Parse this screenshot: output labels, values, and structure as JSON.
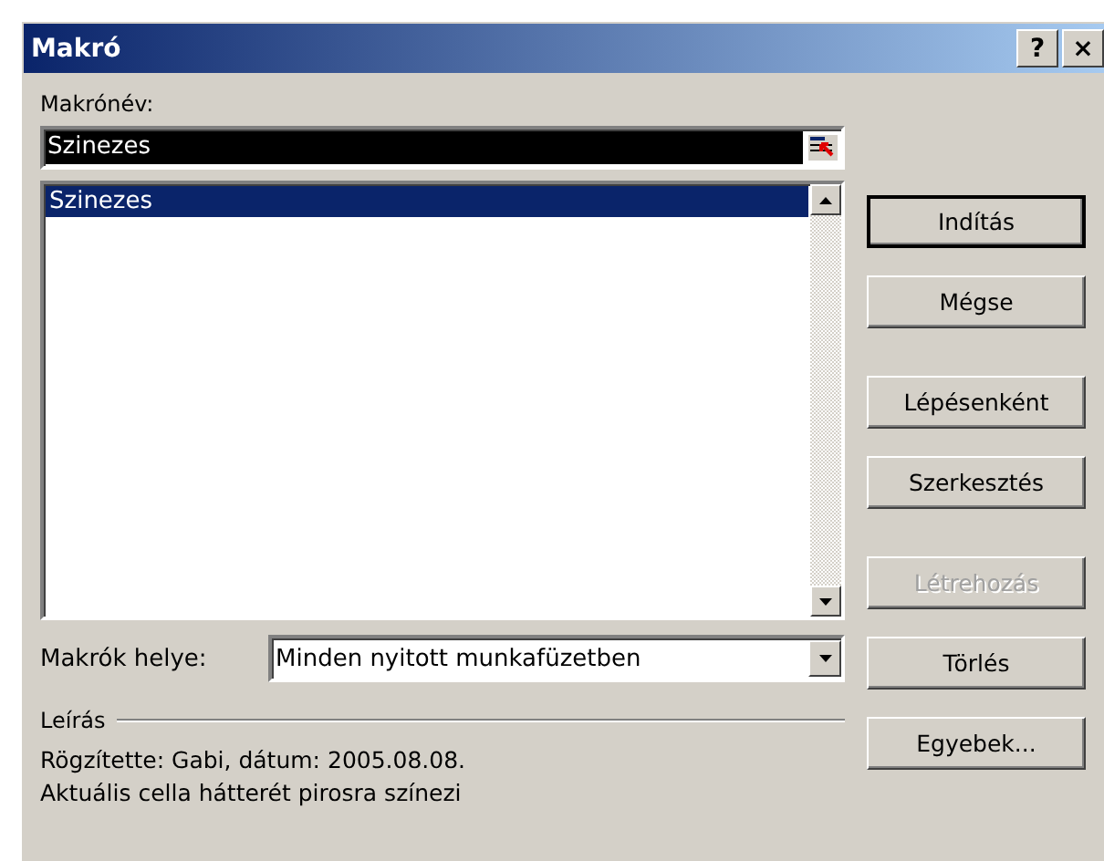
{
  "window": {
    "title": "Makró",
    "help_button": "?",
    "close_button": "×"
  },
  "macro_name": {
    "label": "Makrónév:",
    "value": "Szinezes"
  },
  "macro_list": {
    "items": [
      {
        "label": "Szinezes",
        "selected": true
      }
    ]
  },
  "macros_in": {
    "label": "Makrók helye:",
    "value": "Minden nyitott munkafüzetben"
  },
  "description": {
    "label": "Leírás",
    "lines": [
      "Rögzítette: Gabi, dátum: 2005.08.08.",
      "Aktuális cella hátterét pirosra színezi"
    ]
  },
  "button_groups": [
    [
      {
        "label": "Indítás",
        "disabled": false
      },
      {
        "label": "Mégse",
        "disabled": false
      }
    ],
    [
      {
        "label": "Lépésenként",
        "disabled": false
      },
      {
        "label": "Szerkesztés",
        "disabled": false
      }
    ],
    [
      {
        "label": "Létrehozás",
        "disabled": true
      },
      {
        "label": "Törlés",
        "disabled": false
      },
      {
        "label": "Egyebek...",
        "disabled": false
      }
    ]
  ]
}
